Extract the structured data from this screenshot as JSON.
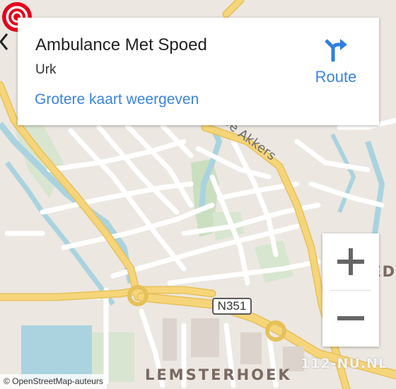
{
  "place": {
    "title": "Ambulance Met Spoed",
    "city": "Urk",
    "larger_map_link": "Grotere kaart weergeven",
    "route_label": "Route",
    "route_icon": "directions-icon"
  },
  "map": {
    "road_labels": [
      "De Akkers"
    ],
    "road_shield": "N351",
    "district_label": "LEMSTERHOEK",
    "district_partial": "ED",
    "attribution": "© OpenStreetMap-auteurs",
    "watermark": "112-NU.NL",
    "zoom_in_icon": "plus-icon",
    "zoom_out_icon": "minus-icon",
    "marker_icon": "location-target-icon",
    "colors": {
      "background": "#ece7e1",
      "major_road": "#f6d57a",
      "water": "#aad3df",
      "park": "#c9dfc0",
      "link": "#3a84df",
      "marker": "#e3001b"
    }
  }
}
